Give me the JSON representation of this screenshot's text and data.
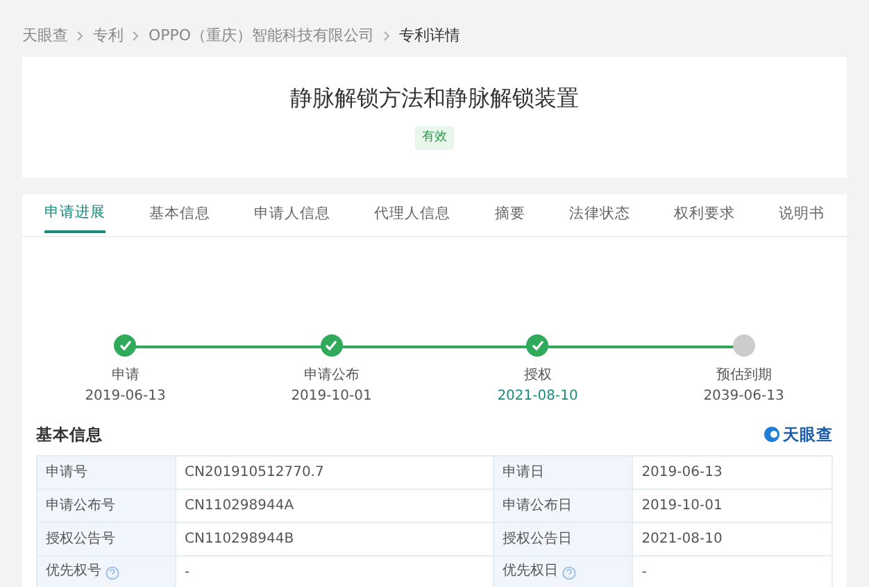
{
  "breadcrumb": [
    "天眼查",
    "专利",
    "OPPO（重庆）智能科技有限公司",
    "专利详情"
  ],
  "patent": {
    "title": "静脉解锁方法和静脉解锁装置",
    "status": "有效"
  },
  "tabs": [
    {
      "label": "申请进展",
      "selected": true
    },
    {
      "label": "基本信息",
      "selected": false
    },
    {
      "label": "申请人信息",
      "selected": false
    },
    {
      "label": "代理人信息",
      "selected": false
    },
    {
      "label": "摘要",
      "selected": false
    },
    {
      "label": "法律状态",
      "selected": false
    },
    {
      "label": "权利要求",
      "selected": false
    },
    {
      "label": "说明书",
      "selected": false
    }
  ],
  "progress": [
    {
      "label": "申请",
      "date": "2019-06-13",
      "done": true,
      "current": false
    },
    {
      "label": "申请公布",
      "date": "2019-10-01",
      "done": true,
      "current": false
    },
    {
      "label": "授权",
      "date": "2021-08-10",
      "done": true,
      "current": true
    },
    {
      "label": "预估到期",
      "date": "2039-06-13",
      "done": false,
      "current": false
    }
  ],
  "basic_info": {
    "title": "基本信息",
    "logo": "天眼查",
    "rows": [
      [
        {
          "label": "申请号",
          "value": "CN201910512770.7",
          "help": false
        },
        {
          "label": "申请日",
          "value": "2019-06-13",
          "help": false
        }
      ],
      [
        {
          "label": "申请公布号",
          "value": "CN110298944A",
          "help": false
        },
        {
          "label": "申请公布日",
          "value": "2019-10-01",
          "help": false
        }
      ],
      [
        {
          "label": "授权公告号",
          "value": "CN110298944B",
          "help": false
        },
        {
          "label": "授权公告日",
          "value": "2021-08-10",
          "help": false
        }
      ],
      [
        {
          "label": "优先权号",
          "value": "-",
          "help": true
        },
        {
          "label": "优先权日",
          "value": "-",
          "help": true
        }
      ]
    ]
  }
}
